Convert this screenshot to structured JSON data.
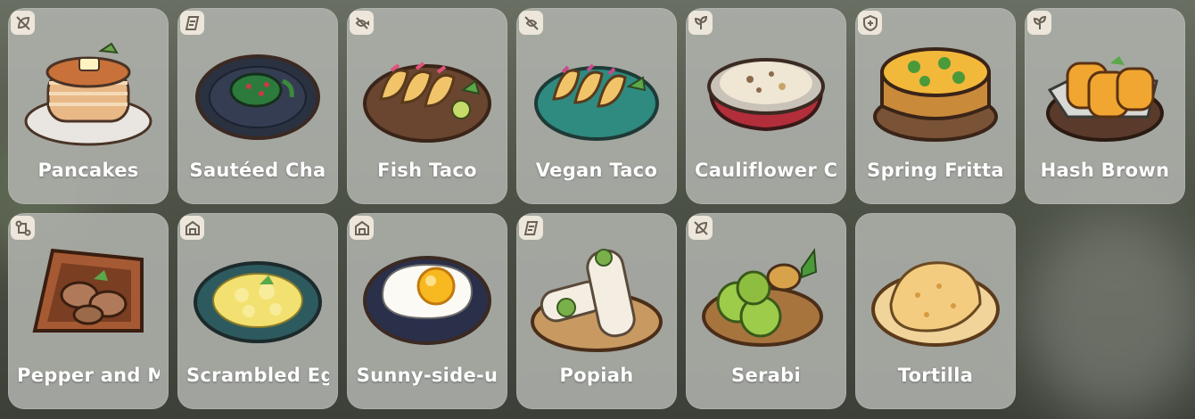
{
  "recipes": [
    {
      "label": "Pancakes",
      "category_icon": "leaf-slash-icon"
    },
    {
      "label": "Sautéed Cha",
      "category_icon": "e-tag-icon"
    },
    {
      "label": "Fish Taco",
      "category_icon": "fish-slash-icon"
    },
    {
      "label": "Vegan Taco",
      "category_icon": "fish-crossed-icon"
    },
    {
      "label": "Cauliflower C",
      "category_icon": "sprout-icon"
    },
    {
      "label": "Spring Fritta",
      "category_icon": "shield-plus-icon"
    },
    {
      "label": "Hash Brown",
      "category_icon": "sprout-icon"
    },
    {
      "label": "Pepper and M",
      "category_icon": "link-nodes-icon"
    },
    {
      "label": "Scrambled Eg",
      "category_icon": "house-icon"
    },
    {
      "label": "Sunny-side-u",
      "category_icon": "house-icon"
    },
    {
      "label": "Popiah",
      "category_icon": "e-tag-icon"
    },
    {
      "label": "Serabi",
      "category_icon": "leaf-slash-icon"
    },
    {
      "label": "Tortilla",
      "category_icon": "none"
    }
  ],
  "colors": {
    "card": "#afb2ac",
    "badge": "#ece6db",
    "label": "#ffffff"
  }
}
